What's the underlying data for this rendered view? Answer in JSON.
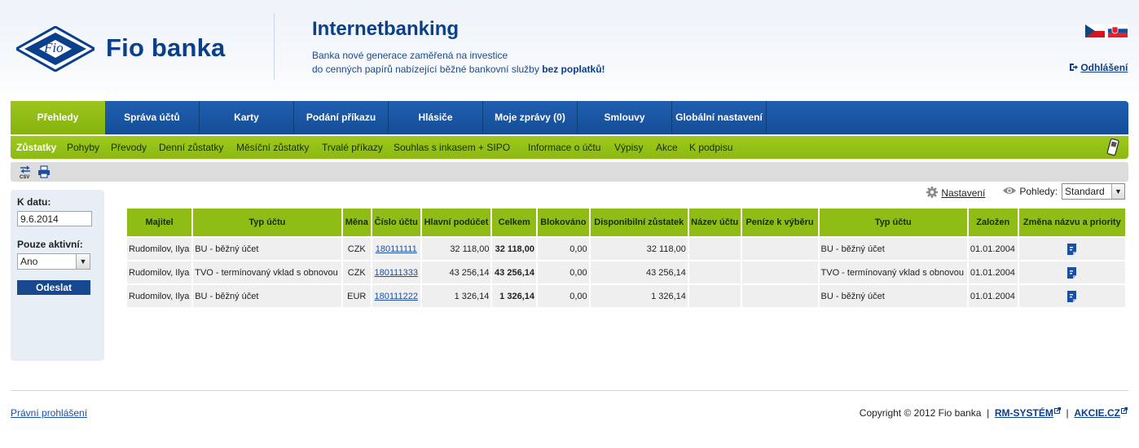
{
  "header": {
    "brand": "Fio banka",
    "logo_mark_text": "Fio",
    "title": "Internetbanking",
    "subtitle_line1": "Banka nové generace zaměřená na investice",
    "subtitle_line2_prefix": "do cenných papírů nabízející běžné bankovní služby",
    "subtitle_line2_bold": "bez poplatků!",
    "logout_label": "Odhlášení"
  },
  "nav": {
    "tabs": [
      {
        "label": "Přehledy",
        "active": true
      },
      {
        "label": "Správa účtů"
      },
      {
        "label": "Karty"
      },
      {
        "label": "Podání příkazu"
      },
      {
        "label": "Hlásiče"
      },
      {
        "label": "Moje zprávy (0)"
      },
      {
        "label": "Smlouvy"
      },
      {
        "label": "Globální nastavení"
      }
    ]
  },
  "subnav": {
    "items": [
      {
        "label": "Zůstatky",
        "active": true
      },
      {
        "label": "Pohyby"
      },
      {
        "label": "Převody"
      },
      {
        "label": "Denní zůstatky"
      },
      {
        "label": "Měsíční zůstatky"
      },
      {
        "label": "Trvalé příkazy"
      },
      {
        "label": "Souhlas s inkasem + SIPO"
      },
      {
        "label": "Informace o účtu"
      },
      {
        "label": "Výpisy"
      },
      {
        "label": "Akce"
      },
      {
        "label": "K podpisu"
      }
    ]
  },
  "filter": {
    "date_label": "K datu:",
    "date_value": "9.6.2014",
    "active_label": "Pouze aktivní:",
    "active_value": "Ano",
    "submit_label": "Odeslat"
  },
  "table_tools": {
    "settings_label": "Nastavení",
    "views_label": "Pohledy:",
    "views_value": "Standard"
  },
  "accounts": {
    "headers": [
      "Majitel",
      "Typ účtu",
      "Měna",
      "Číslo účtu",
      "Hlavní podúčet",
      "Celkem",
      "Blokováno",
      "Disponibilní zůstatek",
      "Název účtu",
      "Peníze k výběru",
      "Typ účtu",
      "Založen",
      "Změna názvu a priority"
    ],
    "rows": [
      {
        "owner": "Rudomilov, Ilya",
        "type": "BU - běžný účet",
        "currency": "CZK",
        "number": "180111111",
        "main": "32 118,00",
        "total": "32 118,00",
        "blocked": "0,00",
        "available": "32 118,00",
        "name": "",
        "withdraw": "",
        "type2": "BU - běžný účet",
        "founded": "01.01.2004"
      },
      {
        "owner": "Rudomilov, Ilya",
        "type": "TVO - termínovaný vklad s obnovou",
        "currency": "CZK",
        "number": "180111333",
        "main": "43 256,14",
        "total": "43 256,14",
        "blocked": "0,00",
        "available": "43 256,14",
        "name": "",
        "withdraw": "",
        "type2": "TVO - termínovaný vklad s obnovou",
        "founded": "01.01.2004"
      },
      {
        "owner": "Rudomilov, Ilya",
        "type": "BU - běžný účet",
        "currency": "EUR",
        "number": "180111222",
        "main": "1 326,14",
        "total": "1 326,14",
        "blocked": "0,00",
        "available": "1 326,14",
        "name": "",
        "withdraw": "",
        "type2": "BU - běžný účet",
        "founded": "01.01.2004"
      }
    ]
  },
  "footer": {
    "legal_label": "Právní prohlášení",
    "copyright": "Copyright © 2012 Fio banka",
    "link1": "RM-SYSTÉM",
    "link2": "AKCIE.CZ",
    "sep": "|"
  },
  "colors": {
    "brand_blue": "#0a3f8c",
    "nav_blue": "#1f5fb0",
    "accent_green": "#8fbd16"
  },
  "icons": [
    "fio-logo-icon",
    "czech-flag-icon",
    "slovak-flag-icon",
    "logout-icon",
    "phone-icon",
    "csv-export-icon",
    "print-icon",
    "gear-icon",
    "eye-icon",
    "edit-icon",
    "external-link-icon"
  ]
}
